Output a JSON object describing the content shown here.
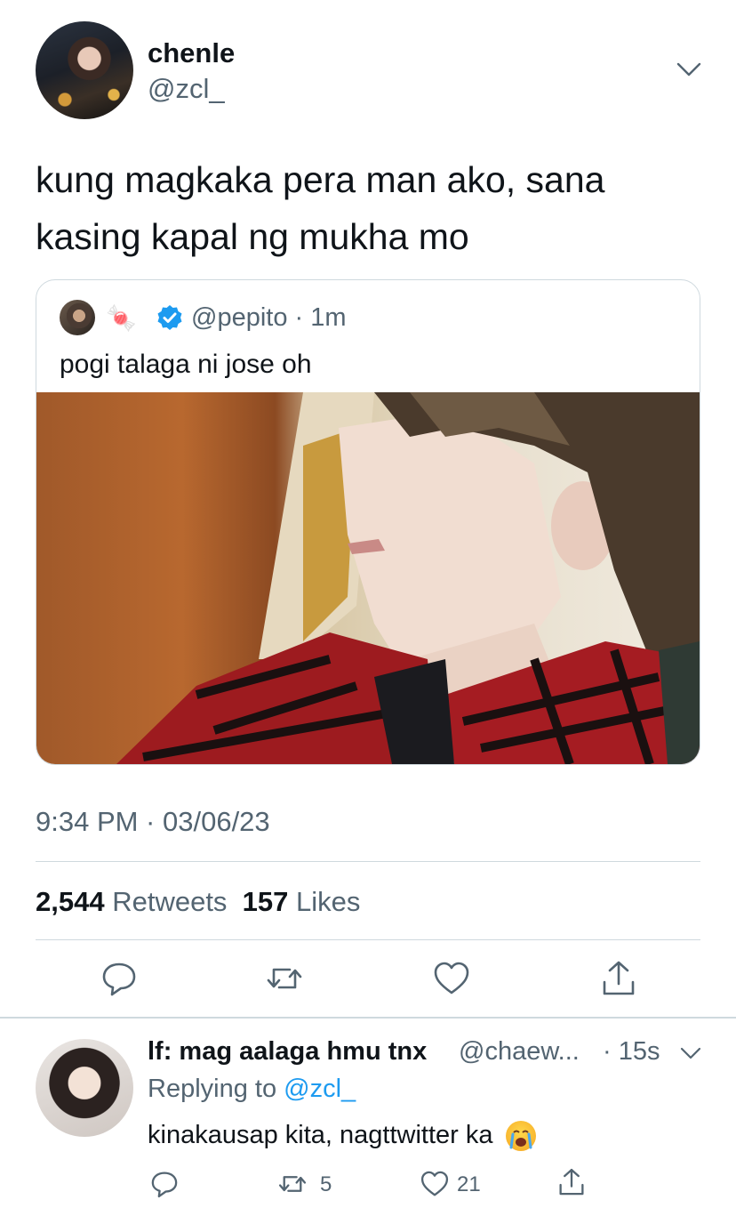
{
  "tweet": {
    "display_name": "chenle",
    "handle": "@zcl_",
    "text": "kung magkaka pera man ako, sana kasing kapal ng mukha mo",
    "timestamp": "9:34 PM · 03/06/23",
    "retweets_count": "2,544",
    "retweets_label": "Retweets",
    "likes_count": "157",
    "likes_label": "Likes"
  },
  "quoted": {
    "emoji": "🍬",
    "handle_time": "@pepito · 1m",
    "text": "pogi talaga ni jose oh"
  },
  "reply": {
    "display_name": "lf: mag aalaga hmu tnx",
    "handle": "@chaew...",
    "time": "· 15s",
    "replying_prefix": "Replying to",
    "replying_handle": "@zcl_",
    "text": "kinakausap kita, nagttwitter ka",
    "retweets": "5",
    "likes": "21"
  },
  "colors": {
    "text": "#0f1419",
    "secondary": "#536471",
    "accent": "#1d9bf0",
    "border": "#cfd9de"
  },
  "icons": [
    "chevron-down-icon",
    "verified-badge-icon",
    "reply-icon",
    "retweet-icon",
    "like-icon",
    "share-icon",
    "loudly-crying-face-emoji"
  ]
}
